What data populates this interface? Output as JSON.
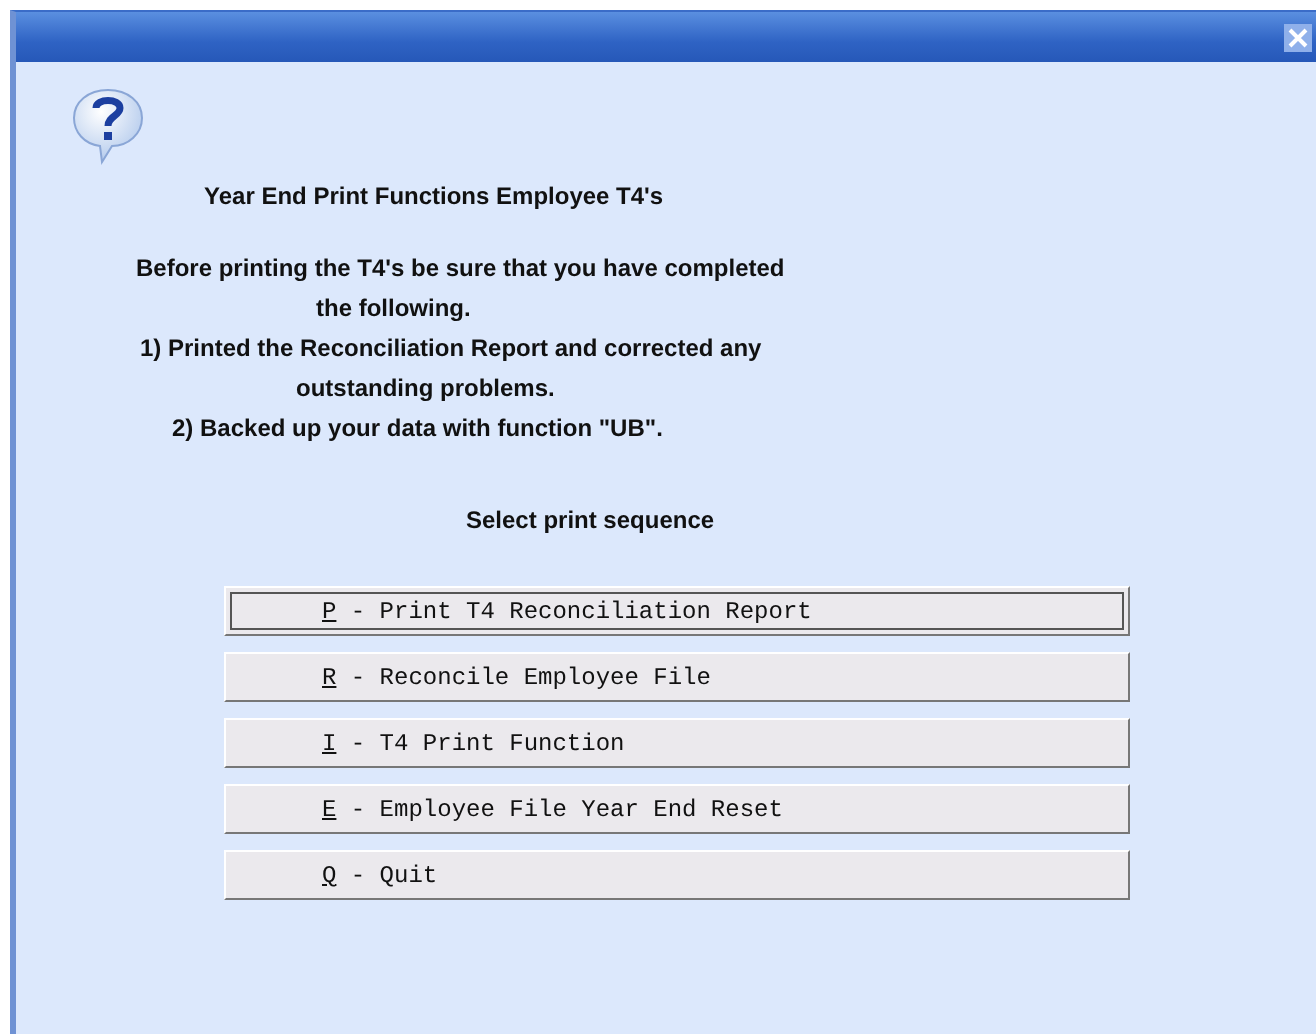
{
  "dialog": {
    "heading": "Year End Print Functions Employee T4's",
    "message_lines": [
      "Before printing the T4's be sure that you have completed",
      "the following.",
      "1) Printed the Reconciliation Report and corrected any",
      "outstanding problems.",
      "2) Backed up your data with function \"UB\"."
    ],
    "prompt": "Select print sequence",
    "options": [
      {
        "key": "P",
        "label": " - Print T4 Reconciliation Report",
        "selected": true
      },
      {
        "key": "R",
        "label": " - Reconcile Employee File",
        "selected": false
      },
      {
        "key": "I",
        "label": " - T4 Print Function",
        "selected": false
      },
      {
        "key": "E",
        "label": " - Employee File Year End Reset",
        "selected": false
      },
      {
        "key": "Q",
        "label": " - Quit",
        "selected": false
      }
    ]
  }
}
